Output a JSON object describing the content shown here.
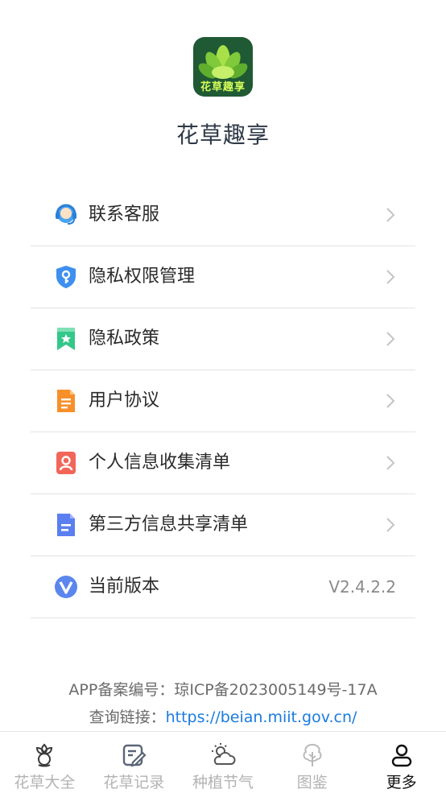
{
  "header": {
    "app_name": "花草趣享",
    "logo_text": "花草趣享"
  },
  "menu": [
    {
      "label": "联系客服",
      "icon": "customer-service-icon"
    },
    {
      "label": "隐私权限管理",
      "icon": "shield-key-icon"
    },
    {
      "label": "隐私政策",
      "icon": "bookmark-star-icon"
    },
    {
      "label": "用户协议",
      "icon": "document-icon"
    },
    {
      "label": "个人信息收集清单",
      "icon": "person-card-icon"
    },
    {
      "label": "第三方信息共享清单",
      "icon": "list-doc-icon"
    },
    {
      "label": "当前版本",
      "icon": "version-v-icon",
      "value": "V2.4.2.2"
    }
  ],
  "footer": {
    "record_text": "APP备案编号：琼ICP备2023005149号-17A",
    "query_label": "查询链接：",
    "query_link": "https://beian.miit.gov.cn/"
  },
  "tabbar": [
    {
      "label": "花草大全",
      "icon": "flower-icon",
      "active": false
    },
    {
      "label": "花草记录",
      "icon": "edit-note-icon",
      "active": false
    },
    {
      "label": "种植节气",
      "icon": "sun-cloud-icon",
      "active": false
    },
    {
      "label": "图鉴",
      "icon": "tree-icon",
      "active": false
    },
    {
      "label": "更多",
      "icon": "user-icon",
      "active": true
    }
  ],
  "colors": {
    "link": "#1a7be0",
    "logo_bg": "#1f5a34",
    "logo_leaf": "#8bd33a"
  }
}
